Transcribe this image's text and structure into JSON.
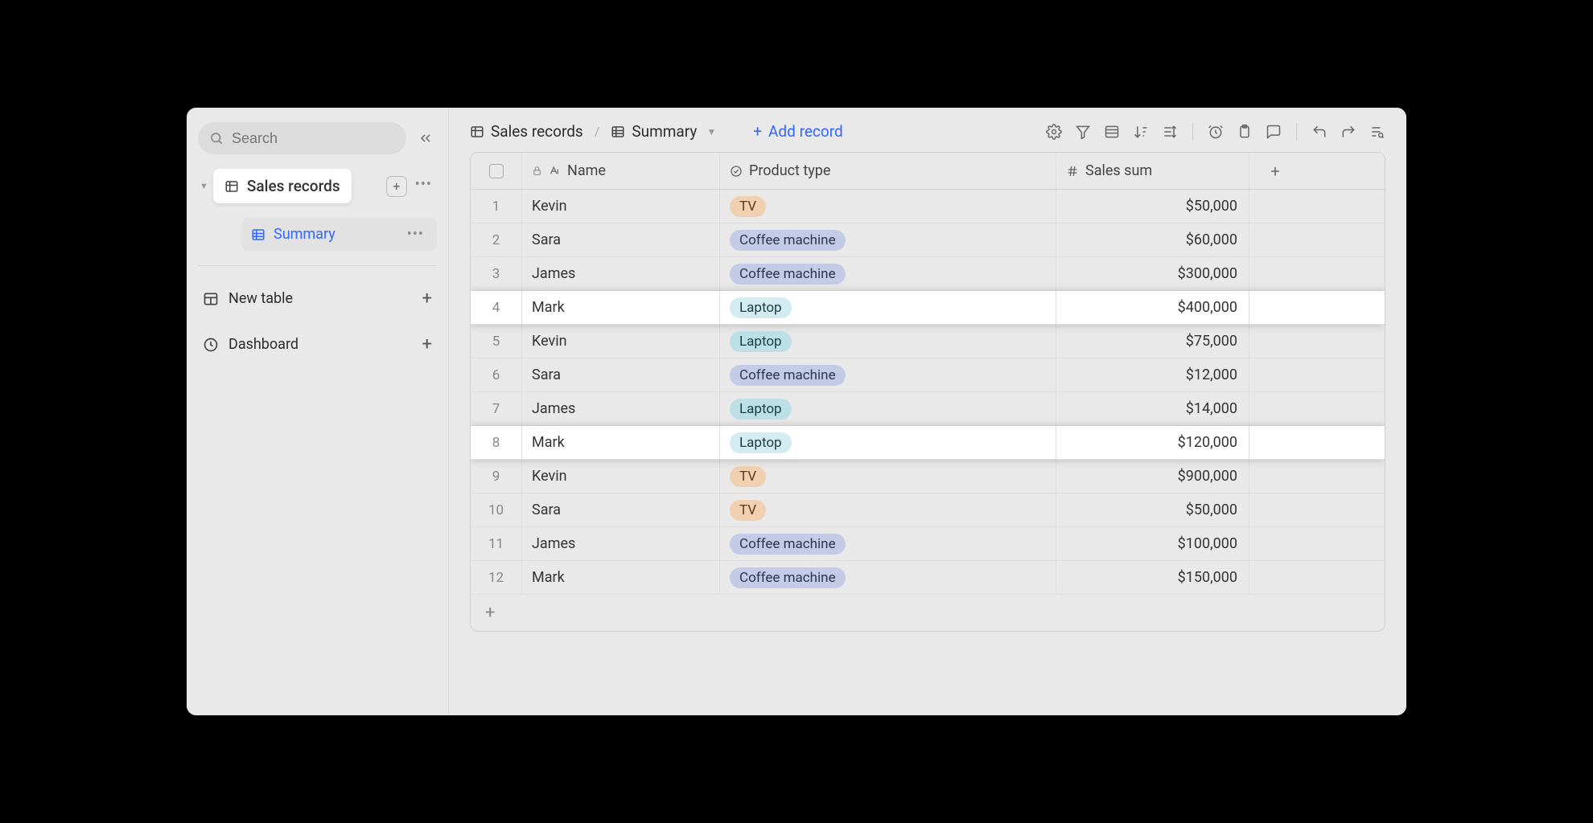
{
  "sidebar": {
    "search_placeholder": "Search",
    "table_name": "Sales records",
    "view_name": "Summary",
    "nav": {
      "new_table": "New table",
      "dashboard": "Dashboard"
    }
  },
  "header": {
    "breadcrumb_table": "Sales records",
    "breadcrumb_view": "Summary",
    "add_record_label": "Add record"
  },
  "columns": {
    "name": "Name",
    "product_type": "Product type",
    "sales_sum": "Sales sum"
  },
  "rows": [
    {
      "num": "1",
      "name": "Kevin",
      "product": "TV",
      "product_class": "tv",
      "sales": "$50,000",
      "highlight": false
    },
    {
      "num": "2",
      "name": "Sara",
      "product": "Coffee machine",
      "product_class": "coffee",
      "sales": "$60,000",
      "highlight": false
    },
    {
      "num": "3",
      "name": "James",
      "product": "Coffee machine",
      "product_class": "coffee",
      "sales": "$300,000",
      "highlight": false
    },
    {
      "num": "4",
      "name": "Mark",
      "product": "Laptop",
      "product_class": "laptop-lt",
      "sales": "$400,000",
      "highlight": true
    },
    {
      "num": "5",
      "name": "Kevin",
      "product": "Laptop",
      "product_class": "laptop",
      "sales": "$75,000",
      "highlight": false
    },
    {
      "num": "6",
      "name": "Sara",
      "product": "Coffee machine",
      "product_class": "coffee",
      "sales": "$12,000",
      "highlight": false
    },
    {
      "num": "7",
      "name": "James",
      "product": "Laptop",
      "product_class": "laptop",
      "sales": "$14,000",
      "highlight": false
    },
    {
      "num": "8",
      "name": "Mark",
      "product": "Laptop",
      "product_class": "laptop-lt",
      "sales": "$120,000",
      "highlight": true
    },
    {
      "num": "9",
      "name": "Kevin",
      "product": "TV",
      "product_class": "tv",
      "sales": "$900,000",
      "highlight": false
    },
    {
      "num": "10",
      "name": "Sara",
      "product": "TV",
      "product_class": "tv",
      "sales": "$50,000",
      "highlight": false
    },
    {
      "num": "11",
      "name": "James",
      "product": "Coffee machine",
      "product_class": "coffee",
      "sales": "$100,000",
      "highlight": false
    },
    {
      "num": "12",
      "name": "Mark",
      "product": "Coffee machine",
      "product_class": "coffee",
      "sales": "$150,000",
      "highlight": false
    }
  ]
}
